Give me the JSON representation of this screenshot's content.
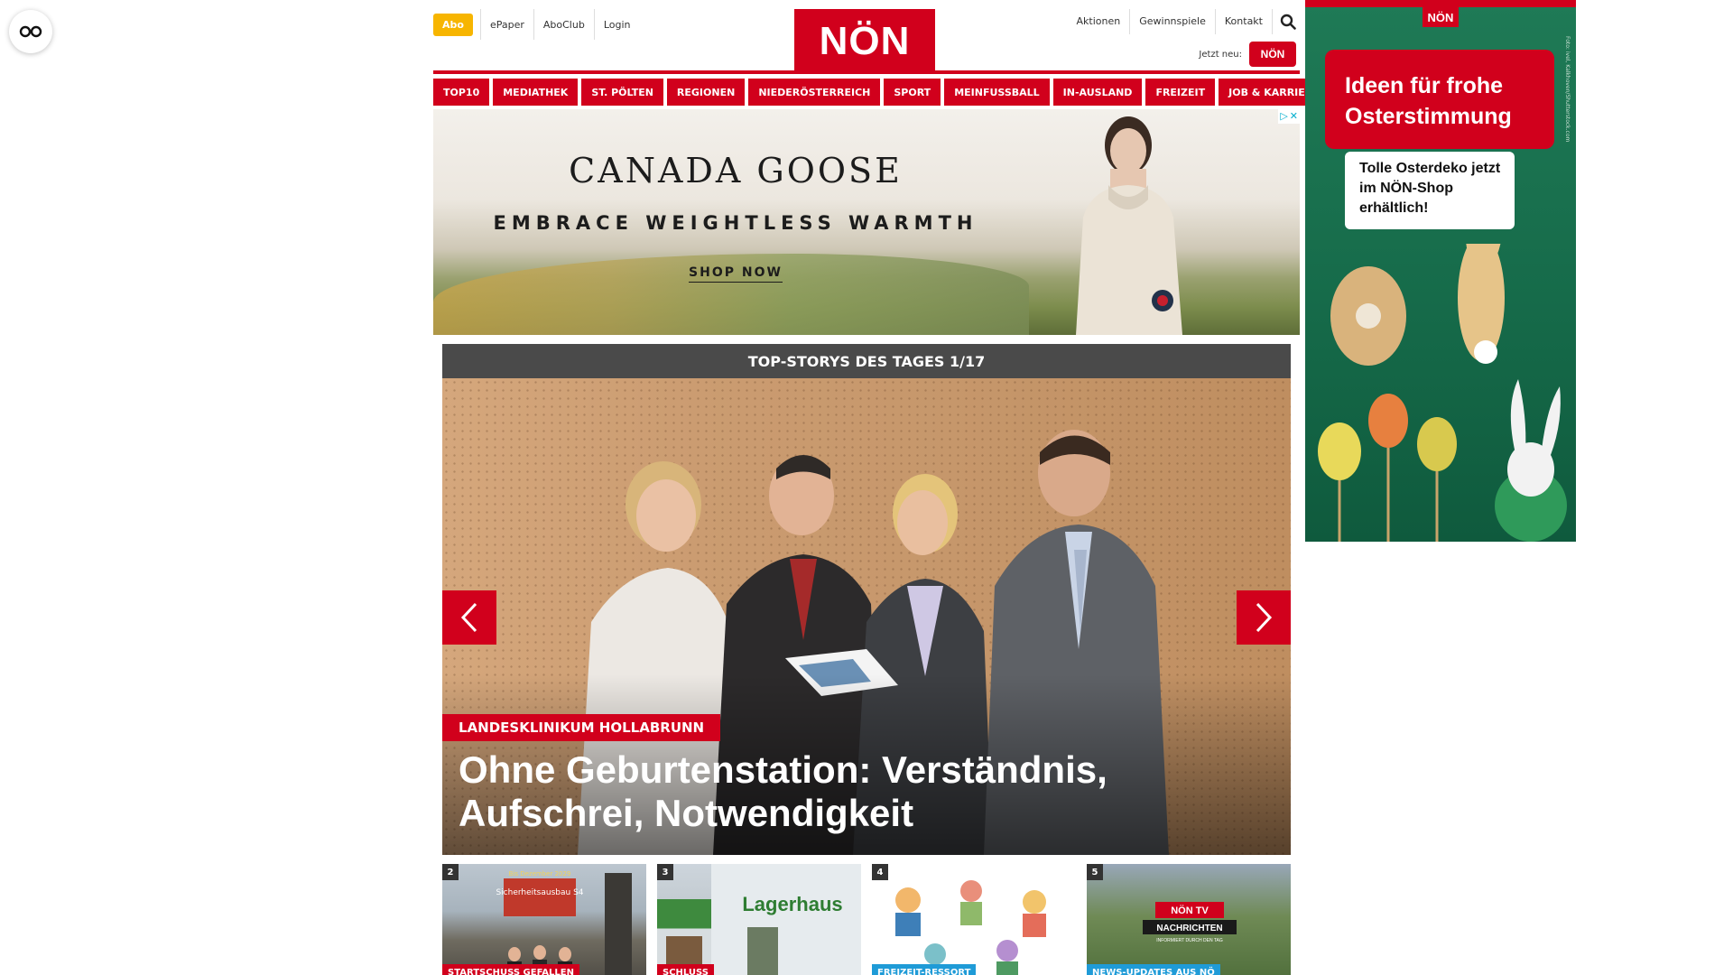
{
  "colors": {
    "brand_red": "#d1001c",
    "abo_yellow": "#f7b500",
    "dark_bar": "#4a4a4a",
    "ad_green": "#166b4a"
  },
  "accessibility": {
    "icon": "accessibility-glasses-icon"
  },
  "header": {
    "abo_label": "Abo",
    "left_links": [
      "ePaper",
      "AboClub",
      "Login"
    ],
    "logo_text": "NÖN",
    "right_links": [
      "Aktionen",
      "Gewinnspiele",
      "Kontakt"
    ],
    "search_icon": "search-icon",
    "jetzt_label": "Jetzt neu:",
    "meine_noen_logo": "NÖN"
  },
  "nav": [
    "TOP10",
    "MEDIATHEK",
    "ST. PÖLTEN",
    "REGIONEN",
    "NIEDERÖSTERREICH",
    "SPORT",
    "MEINFUSSBALL",
    "IN-AUSLAND",
    "FREIZEIT",
    "JOB & KARRIERE"
  ],
  "banner_ad": {
    "brand": "CANADA GOOSE",
    "tagline": "EMBRACE WEIGHTLESS WARMTH",
    "cta": "SHOP NOW",
    "adchoices_icon": "adchoices-icon",
    "close_icon": "close-icon"
  },
  "topstories": {
    "header": "TOP-STORYS DES TAGES 1/17",
    "hero": {
      "kicker": "LANDESKLINIKUM HOLLABRUNN",
      "title": "Ohne Geburtenstation: Verständnis, Aufschrei, Notwendigkeit"
    },
    "thumbs": [
      {
        "num": "2",
        "tag": "STARTSCHUSS GEFALLEN",
        "tag_color": "#d1001c",
        "overlay_text": "Sicherheitsausbau S4",
        "date_text": "Bis Dezember 2029"
      },
      {
        "num": "3",
        "tag": "SCHLUSS",
        "tag_color": "#d1001c",
        "overlay_text": "Lagerhaus"
      },
      {
        "num": "4",
        "tag": "FREIZEIT-RESSORT",
        "tag_color": "#1f9bd7"
      },
      {
        "num": "5",
        "tag": "NEWS-UPDATES AUS NÖ",
        "tag_color": "#1f9bd7",
        "logo_text": "NÖN TV",
        "overlay_text": "NACHRICHTEN",
        "overlay_sub": "INFORMIERT DURCH DEN TAG"
      }
    ]
  },
  "sky_ad": {
    "logo": "NÖN",
    "headline": "Ideen für frohe Osterstimmung",
    "sub": "Tolle Osterdeko jetzt im NÖN-Shop erhältlich!",
    "credit": "Foto: ivel, Kalkhoven/Shutterstock.com"
  }
}
